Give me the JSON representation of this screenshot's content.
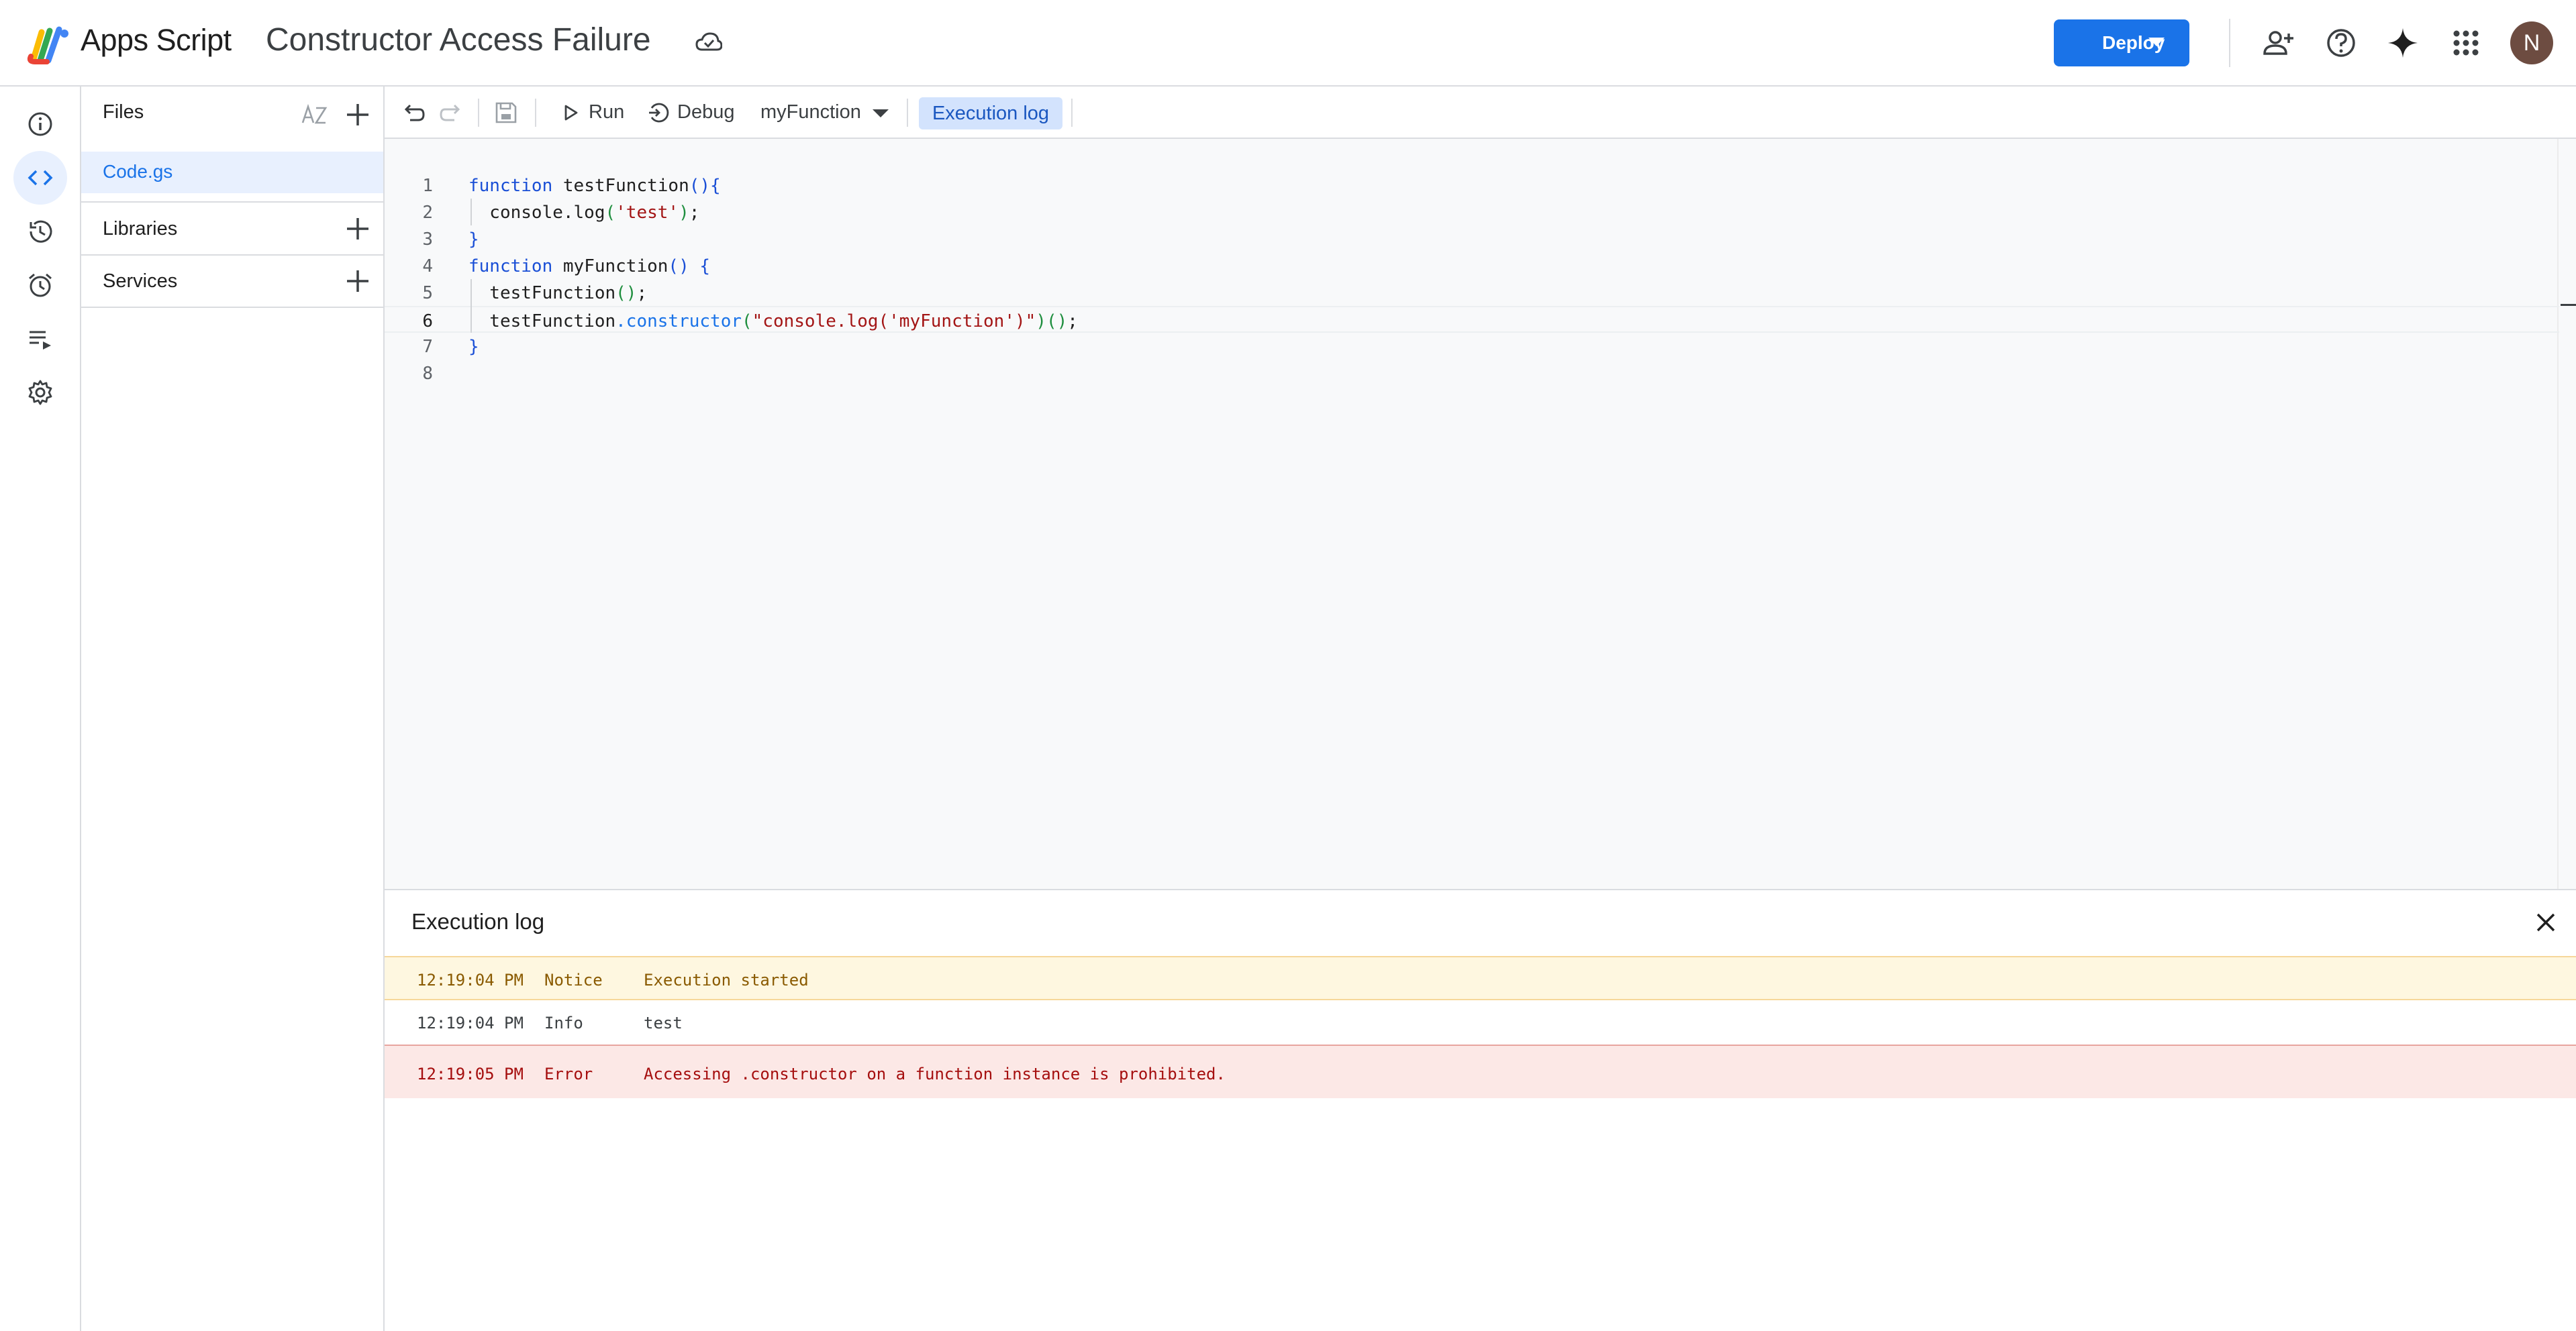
{
  "header": {
    "app_name": "Apps Script",
    "project_title": "Constructor Access Failure",
    "deploy_label": "Deploy",
    "avatar_initial": "N",
    "icons": [
      "cloud-saved-icon",
      "add-collaborator-icon",
      "help-icon",
      "gemini-spark-icon",
      "apps-grid-icon"
    ]
  },
  "rail": {
    "items": [
      "overview-icon",
      "editor-icon",
      "history-icon",
      "triggers-icon",
      "executions-icon",
      "settings-icon"
    ],
    "active": "editor-icon"
  },
  "files_panel": {
    "files_title": "Files",
    "files": [
      {
        "name": "Code.gs",
        "selected": true
      }
    ],
    "libraries_title": "Libraries",
    "services_title": "Services"
  },
  "toolbar": {
    "run_label": "Run",
    "debug_label": "Debug",
    "function_name": "myFunction",
    "execution_log_label": "Execution log"
  },
  "editor": {
    "current_line": 6,
    "lines": [
      {
        "no": "1",
        "text": "function testFunction(){"
      },
      {
        "no": "2",
        "text": "  console.log('test');"
      },
      {
        "no": "3",
        "text": "}"
      },
      {
        "no": "4",
        "text": "function myFunction() {"
      },
      {
        "no": "5",
        "text": "  testFunction();"
      },
      {
        "no": "6",
        "text": "  testFunction.constructor(\"console.log('myFunction')\")();"
      },
      {
        "no": "7",
        "text": "}"
      },
      {
        "no": "8",
        "text": ""
      }
    ]
  },
  "execution_log": {
    "title": "Execution log",
    "entries": [
      {
        "time": "12:19:04 PM",
        "level": "Notice",
        "message": "Execution started"
      },
      {
        "time": "12:19:04 PM",
        "level": "Info",
        "message": "test"
      },
      {
        "time": "12:19:05 PM",
        "level": "Error",
        "message": "Accessing .constructor on a function instance is prohibited."
      }
    ]
  },
  "colors": {
    "accent": "#1a73e8",
    "selected_bg": "#e8f0fe",
    "notice_bg": "#fef7e0",
    "error_bg": "#fce8e6",
    "error_text": "#a50e0e"
  }
}
